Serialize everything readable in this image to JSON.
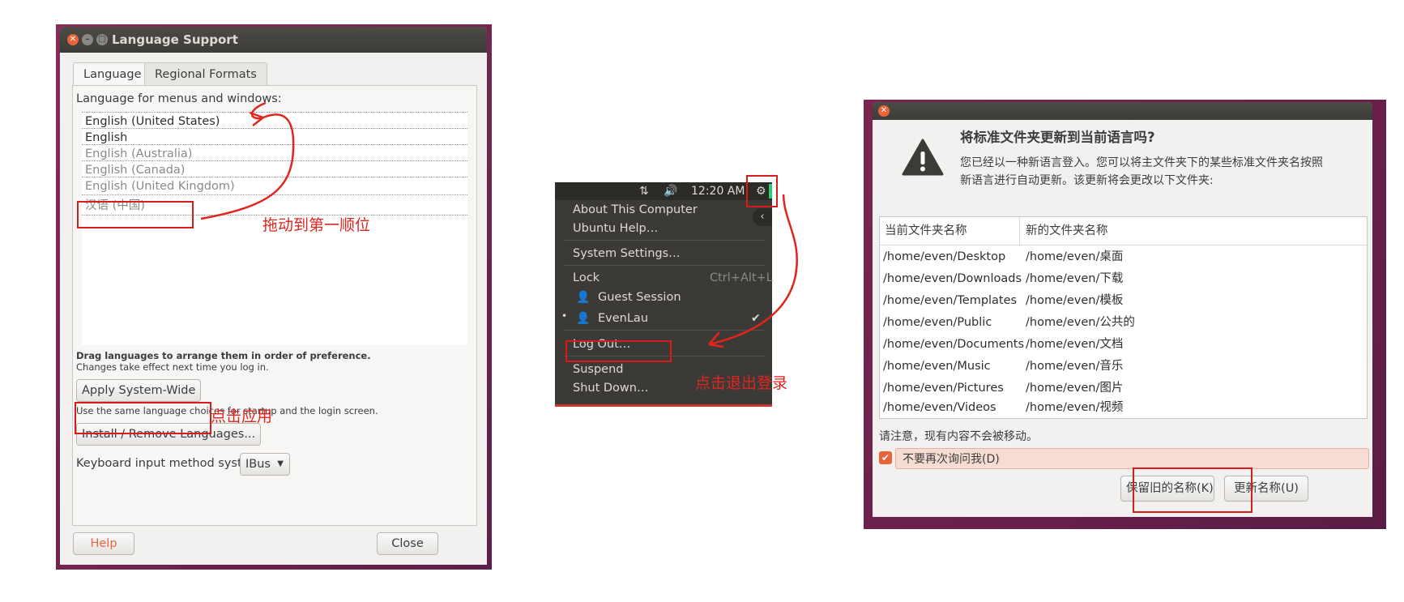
{
  "language_support": {
    "title": "Language Support",
    "tabs": [
      "Language",
      "Regional Formats"
    ],
    "list_label": "Language for menus and windows:",
    "languages": [
      "English (United States)",
      "English",
      "English (Australia)",
      "English (Canada)",
      "English (United Kingdom)",
      "汉语 (中国)"
    ],
    "drag_hint": "Drag languages to arrange them in order of preference.",
    "drag_subhint": "Changes take effect next time you log in.",
    "apply_button": "Apply System-Wide",
    "apply_note": "Use the same language choices for startup and the login screen.",
    "install_button": "Install / Remove Languages...",
    "keyboard_label": "Keyboard input method system:",
    "keyboard_value": "IBus",
    "help_button": "Help",
    "close_button": "Close",
    "annotation_drag": "拖动到第一顺位",
    "annotation_apply": "点击应用"
  },
  "system_menu": {
    "time": "12:20 AM",
    "items": {
      "about": "About This Computer",
      "help": "Ubuntu Help…",
      "settings": "System Settings…",
      "lock": "Lock",
      "lock_shortcut": "Ctrl+Alt+L",
      "guest": "Guest Session",
      "user": "EvenLau",
      "logout": "Log Out…",
      "suspend": "Suspend",
      "shutdown": "Shut Down…"
    },
    "annotation_logout": "点击退出登录"
  },
  "folder_dialog": {
    "heading": "将标准文件夹更新到当前语言吗?",
    "message_line1": "您已经以一种新语言登入。您可以将主文件夹下的某些标准文件夹名按照",
    "message_line2": "新语言进行自动更新。该更新将会更改以下文件夹:",
    "columns": [
      "当前文件夹名称",
      "新的文件夹名称"
    ],
    "rows": [
      [
        "/home/even/Desktop",
        "/home/even/桌面"
      ],
      [
        "/home/even/Downloads",
        "/home/even/下载"
      ],
      [
        "/home/even/Templates",
        "/home/even/模板"
      ],
      [
        "/home/even/Public",
        "/home/even/公共的"
      ],
      [
        "/home/even/Documents",
        "/home/even/文档"
      ],
      [
        "/home/even/Music",
        "/home/even/音乐"
      ],
      [
        "/home/even/Pictures",
        "/home/even/图片"
      ],
      [
        "/home/even/Videos",
        "/home/even/视频"
      ]
    ],
    "note": "请注意，现有内容不会被移动。",
    "checkbox_label": "不要再次询问我(D)",
    "keep_button": "保留旧的名称(K)",
    "update_button": "更新名称(U)"
  },
  "colors": {
    "accent": "#e9643b",
    "annotation": "#e0251f",
    "wallpaper": "#7a2551"
  }
}
